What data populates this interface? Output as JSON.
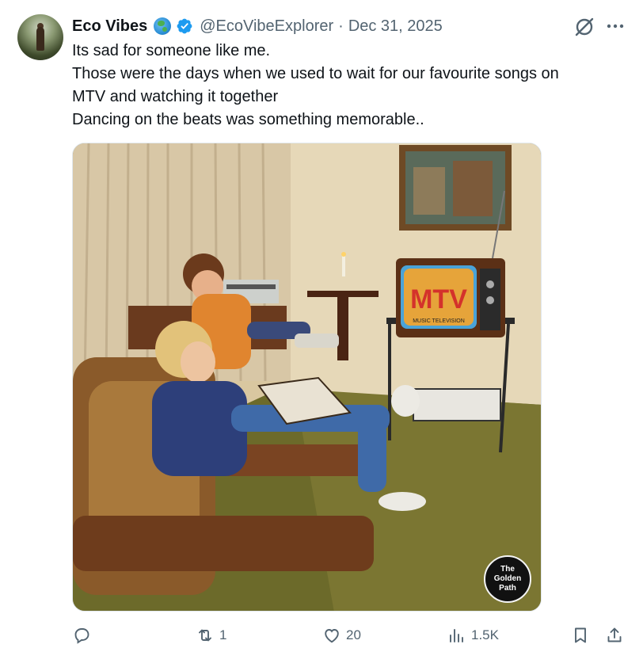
{
  "author": {
    "display_name": "Eco Vibes",
    "handle": "@EcoVibeExplorer",
    "separator": "·",
    "date": "Dec 31, 2025",
    "name_emoji": "globe-icon",
    "verified_badge": "verified-badge-icon",
    "verified_color": "#1d9bf0"
  },
  "tweet": {
    "lines": [
      "Its sad for someone like me.",
      "Those were the days when we used to wait for our favourite songs on",
      "MTV and watching it together",
      "Dancing on the beats was something memorable.."
    ]
  },
  "media": {
    "watermark": "The Golden Path",
    "tv_logo": "MTV",
    "tv_caption": "MUSIC TELEVISION"
  },
  "actions": {
    "reply_count": "",
    "retweet_count": "1",
    "like_count": "20",
    "views_count": "1.5K"
  },
  "icons": [
    "grok-icon",
    "more-icon",
    "reply-icon",
    "retweet-icon",
    "like-icon",
    "views-icon",
    "bookmark-icon",
    "share-icon"
  ]
}
